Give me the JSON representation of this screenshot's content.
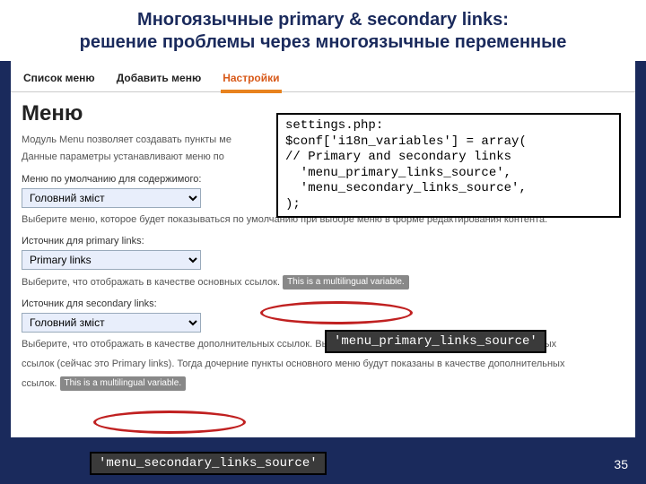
{
  "title": {
    "line1": "Многоязычные primary & secondary links:",
    "line2": "решение проблемы через многоязычные переменные"
  },
  "tabs": {
    "list": "Список меню",
    "add": "Добавить меню",
    "settings": "Настройки"
  },
  "heading": "Меню",
  "desc": {
    "line1": "Модуль Menu позволяет создавать пункты ме",
    "line2": "Данные параметры устанавливают меню по"
  },
  "fields": {
    "default": {
      "label": "Меню по умолчанию для содержимого:",
      "value": "Головний зміст",
      "helper": "Выберите меню, которое будет показываться по умолчанию при выборе меню в форме редактирования контента."
    },
    "primary": {
      "label": "Источник для primary links:",
      "value": "Primary links",
      "helper": "Выберите, что отображать в качестве основных ссылок.",
      "badge": "This is a multilingual variable."
    },
    "secondary": {
      "label": "Источник для secondary links:",
      "value": "Головний зміст",
      "helper1": "Выберите, что отображать в качестве дополнительных ссылок. Вы можете выбрать то же меню, как и для основных",
      "helper2": "ссылок (сейчас это Primary links). Тогда дочерние пункты основного меню будут показаны в качестве дополнительных",
      "helper3": "ссылок.",
      "badge": "This is a multilingual variable."
    }
  },
  "code_overlay": "settings.php:\n$conf['i18n_variables'] = array(\n// Primary and secondary links\n  'menu_primary_links_source',\n  'menu_secondary_links_source',\n);",
  "code_labels": {
    "primary": "'menu_primary_links_source'",
    "secondary": "'menu_secondary_links_source'"
  },
  "slide_number": "35"
}
